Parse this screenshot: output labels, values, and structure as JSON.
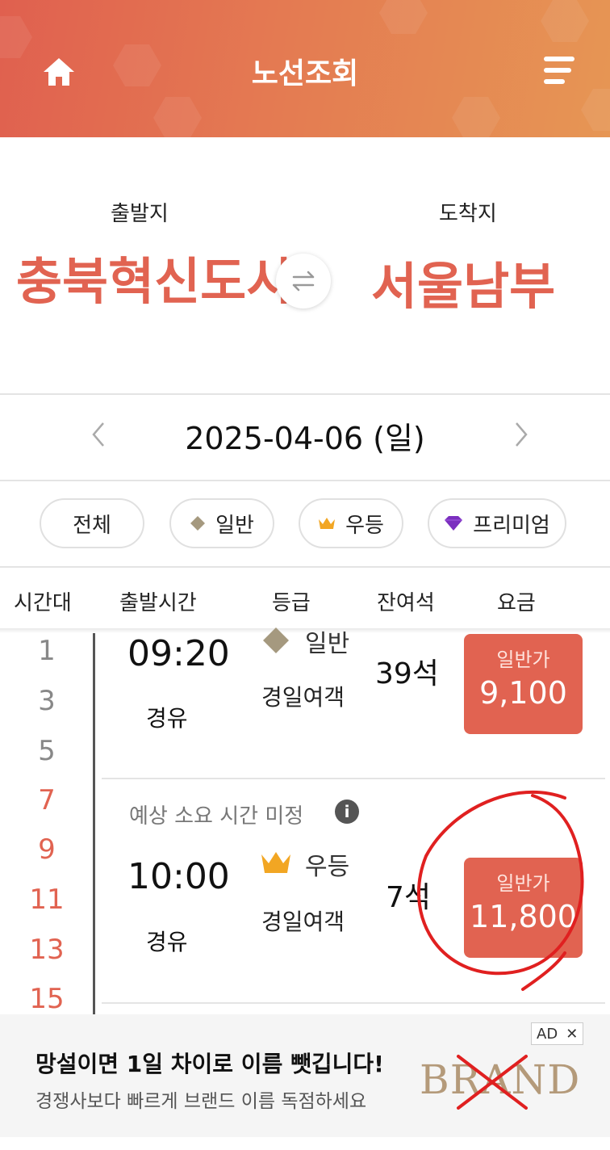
{
  "header": {
    "title": "노선조회",
    "home_icon": "home-icon",
    "menu_icon": "menu-icon"
  },
  "route": {
    "departure_label": "출발지",
    "departure": "충북혁신도시",
    "arrival_label": "도착지",
    "arrival": "서울남부",
    "swap_icon": "swap-arrows-icon"
  },
  "date": {
    "value": "2025-04-06 (일)"
  },
  "filters": [
    {
      "label": "전체"
    },
    {
      "label": "일반",
      "icon": "diamond-icon"
    },
    {
      "label": "우등",
      "icon": "crown-icon"
    },
    {
      "label": "프리미엄",
      "icon": "gem-icon"
    }
  ],
  "table_headers": [
    "시간대",
    "출발시간",
    "등급",
    "잔여석",
    "요금"
  ],
  "hours": [
    "1",
    "3",
    "5",
    "7",
    "9",
    "11",
    "13",
    "15"
  ],
  "rows": [
    {
      "time": "09:20",
      "via": "경유",
      "grade": "일반",
      "company": "경일여객",
      "seats": "39석",
      "fare_type": "일반가",
      "fare": "9,100"
    },
    {
      "note": "예상 소요 시간 미정",
      "time": "10:00",
      "via": "경유",
      "grade": "우등",
      "company": "경일여객",
      "seats": "7석",
      "fare_type": "일반가",
      "fare": "11,800"
    }
  ],
  "ad": {
    "title": "망설이면 1일 차이로 이름 뺏깁니다!",
    "subtitle": "경쟁사보다 빠르게 브랜드 이름 독점하세요",
    "tag": "AD",
    "close": "✕",
    "logo": "BRAND"
  },
  "colors": {
    "accent": "#e16351",
    "header_start": "#e0604f",
    "header_end": "#e69654"
  }
}
